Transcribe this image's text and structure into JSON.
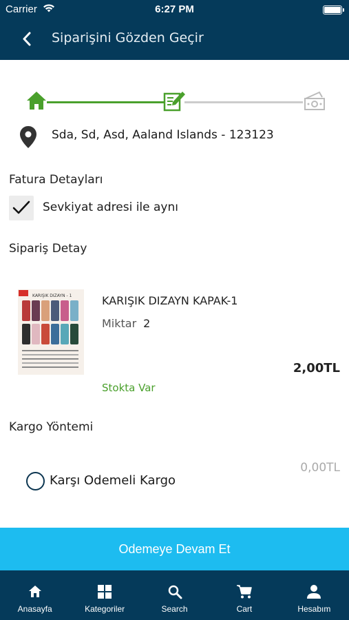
{
  "status_bar": {
    "carrier": "Carrier",
    "time": "6:27 PM"
  },
  "header": {
    "title": "Siparişini Gözden Geçir"
  },
  "address": {
    "text": "Sda, Sd, Asd, Aaland Islands - 123123"
  },
  "billing": {
    "title": "Fatura Detayları",
    "same_as_shipping_label": "Sevkiyat adresi ile aynı",
    "same_as_shipping_checked": true
  },
  "order": {
    "title": "Sipariş Detay",
    "item": {
      "name": "KARIŞIK DIZAYN KAPAK-1",
      "qty_label": "Miktar",
      "qty_value": "2",
      "price": "2,00TL",
      "stock": "Stokta Var",
      "image_caption": "KARIŞIK DIZAYN - 1"
    }
  },
  "shipping": {
    "title": "Kargo Yöntemi",
    "option_label": "Karşı Odemeli Kargo",
    "option_price": "0,00TL"
  },
  "cta": {
    "label": "Odemeye Devam Et"
  },
  "tabbar": {
    "items": [
      {
        "label": "Anasayfa",
        "icon": "home-icon"
      },
      {
        "label": "Kategoriler",
        "icon": "grid-icon"
      },
      {
        "label": "Search",
        "icon": "search-icon"
      },
      {
        "label": "Cart",
        "icon": "cart-icon"
      },
      {
        "label": "Hesabım",
        "icon": "person-icon"
      }
    ]
  },
  "colors": {
    "header_bg": "#053a5a",
    "accent_green": "#4aa02c",
    "cta_blue": "#1dbcf0",
    "step_inactive": "#cccccc"
  }
}
